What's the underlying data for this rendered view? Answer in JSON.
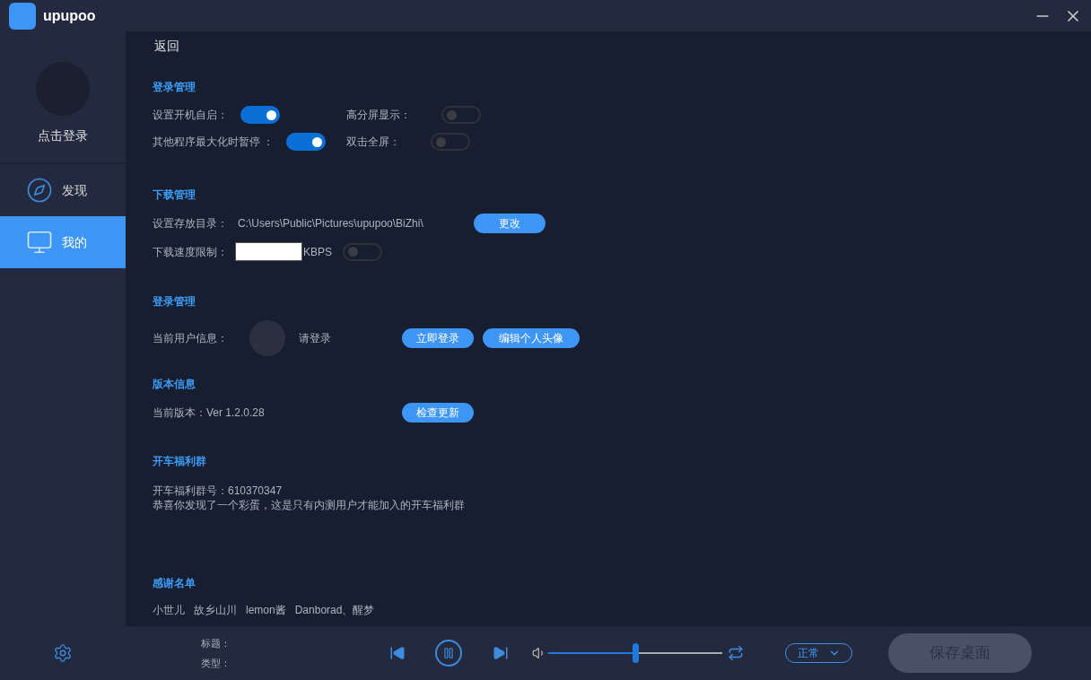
{
  "app": {
    "logo_text": "upupoo"
  },
  "back": "返回",
  "user": {
    "login_label": "点击登录"
  },
  "nav": [
    {
      "label": "发现",
      "selected": false
    },
    {
      "label": "我的",
      "selected": true
    }
  ],
  "sections": [
    {
      "kind": "toggles",
      "title": "登录管理",
      "toggles": [
        {
          "label": "设置开机自启：",
          "on": true
        },
        {
          "label": "高分屏显示：",
          "on": false
        },
        {
          "label": "其他程序最大化时暂停 ：",
          "on": true
        },
        {
          "label": "双击全屏：",
          "on": false
        }
      ]
    },
    {
      "kind": "download",
      "title": "下载管理",
      "dir_label": "设置存放目录：",
      "dir_path": "C:\\Users\\Public\\Pictures\\upupoo\\BiZhi\\",
      "change_button": "更改",
      "speed_label": "下载速度限制：",
      "speed_unit": "KBPS",
      "speed_limit_on": false
    },
    {
      "kind": "account",
      "title": "登录管理",
      "user_label": "当前用户信息：",
      "user_status": "请登录",
      "buttons": [
        "立即登录",
        "编辑个人头像"
      ]
    },
    {
      "kind": "version",
      "title": "版本信息",
      "version_text": "当前版本：Ver 1.2.0.28",
      "button": "检查更新"
    },
    {
      "kind": "group",
      "title": "开车福利群",
      "lines": [
        "开车福利群号：610370347",
        "恭喜你发现了一个彩蛋，这是只有内测用户才能加入的开车福利群"
      ]
    },
    {
      "kind": "credits",
      "title": "感谢名单",
      "names": [
        "小世儿",
        "故乡山川",
        "lemon酱",
        "Danborad、醒梦"
      ]
    }
  ],
  "player": {
    "title_label": "标题：",
    "type_label": "类型：",
    "playing": true,
    "volume": {
      "level": 0.5
    },
    "mode": "正常",
    "save_button": {
      "label": "保存桌面",
      "disabled": true
    }
  }
}
